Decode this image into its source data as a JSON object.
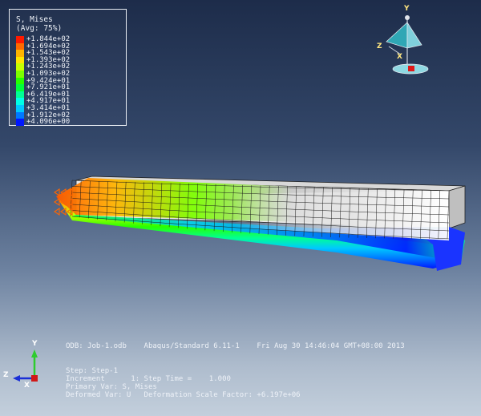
{
  "legend": {
    "title_line1": "S, Mises",
    "title_line2": "(Avg: 75%)",
    "entries": [
      {
        "label": "+1.844e+02",
        "color": "#ff1a00"
      },
      {
        "label": "+1.694e+02",
        "color": "#ff6a00"
      },
      {
        "label": "+1.543e+02",
        "color": "#ffb400"
      },
      {
        "label": "+1.393e+02",
        "color": "#ffe600"
      },
      {
        "label": "+1.243e+02",
        "color": "#c8ff00"
      },
      {
        "label": "+1.093e+02",
        "color": "#7cff00"
      },
      {
        "label": "+9.424e+01",
        "color": "#28ff00"
      },
      {
        "label": "+7.921e+01",
        "color": "#00ff3c"
      },
      {
        "label": "+6.419e+01",
        "color": "#00ff96"
      },
      {
        "label": "+4.917e+01",
        "color": "#00ffe6"
      },
      {
        "label": "+3.414e+01",
        "color": "#00c8ff"
      },
      {
        "label": "+1.912e+02",
        "color": "#0078ff"
      },
      {
        "label": "+4.096e+00",
        "color": "#0018ff"
      }
    ]
  },
  "view_triad": {
    "y": "Y",
    "z": "Z",
    "x": "X"
  },
  "axis_triad": {
    "y": "Y",
    "z": "Z",
    "x": "X"
  },
  "info": {
    "line1": "ODB: Job-1.odb    Abaqus/Standard 6.11-1    Fri Aug 30 14:46:04 GMT+08:00 2013",
    "line2": "Step: Step-1",
    "line3": "Increment      1: Step Time =    1.000",
    "line4": "Primary Var: S, Mises",
    "line5": "Deformed Var: U   Deformation Scale Factor: +6.197e+06"
  },
  "colors": {
    "background_top": "#1d2c4a",
    "background_bottom": "#c3cfdc",
    "mesh_line": "#1a1a1a",
    "boundary_condition": "#ff6600"
  }
}
